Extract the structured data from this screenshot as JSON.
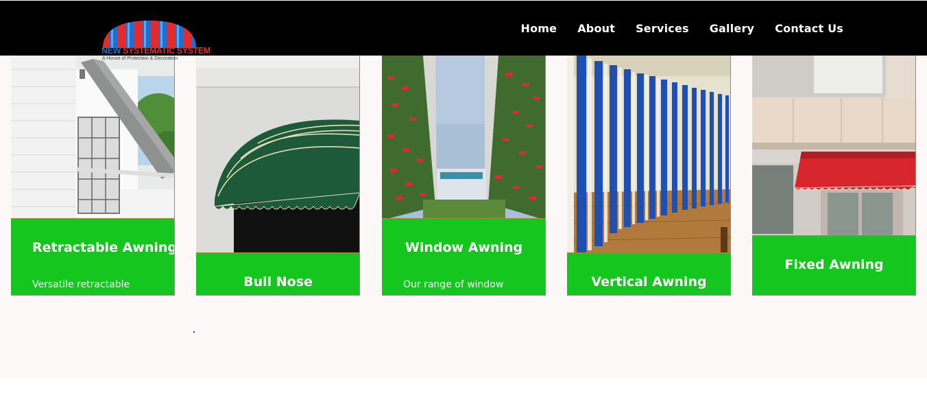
{
  "brand": {
    "name_part1": "NEW ",
    "name_part2": "SYSTEMATIC SYSTEM",
    "tagline": "A House of Protection & Decoration",
    "colors": {
      "red": "#e22b2b",
      "blue": "#1b6fd6"
    }
  },
  "nav": {
    "items": [
      {
        "label": "Home"
      },
      {
        "label": "About"
      },
      {
        "label": "Services"
      },
      {
        "label": "Gallery"
      },
      {
        "label": "Contact Us"
      }
    ]
  },
  "cards": [
    {
      "title": "Retractable Awning",
      "desc": "Versatile retractable",
      "image": "retractable-awning-photo"
    },
    {
      "title": "Bull Nose",
      "desc": "",
      "image": "bull-nose-awning-photo"
    },
    {
      "title": "Window Awning",
      "desc": "Our range of window",
      "image": "window-awning-photo"
    },
    {
      "title": "Vertical Awning",
      "desc": "",
      "image": "vertical-awning-photo"
    },
    {
      "title": "Fixed Awning",
      "desc": "",
      "image": "fixed-awning-photo"
    }
  ],
  "colors": {
    "card_band": "#14c61e",
    "navbar": "#000000",
    "page_bg": "#fdf8f8"
  }
}
